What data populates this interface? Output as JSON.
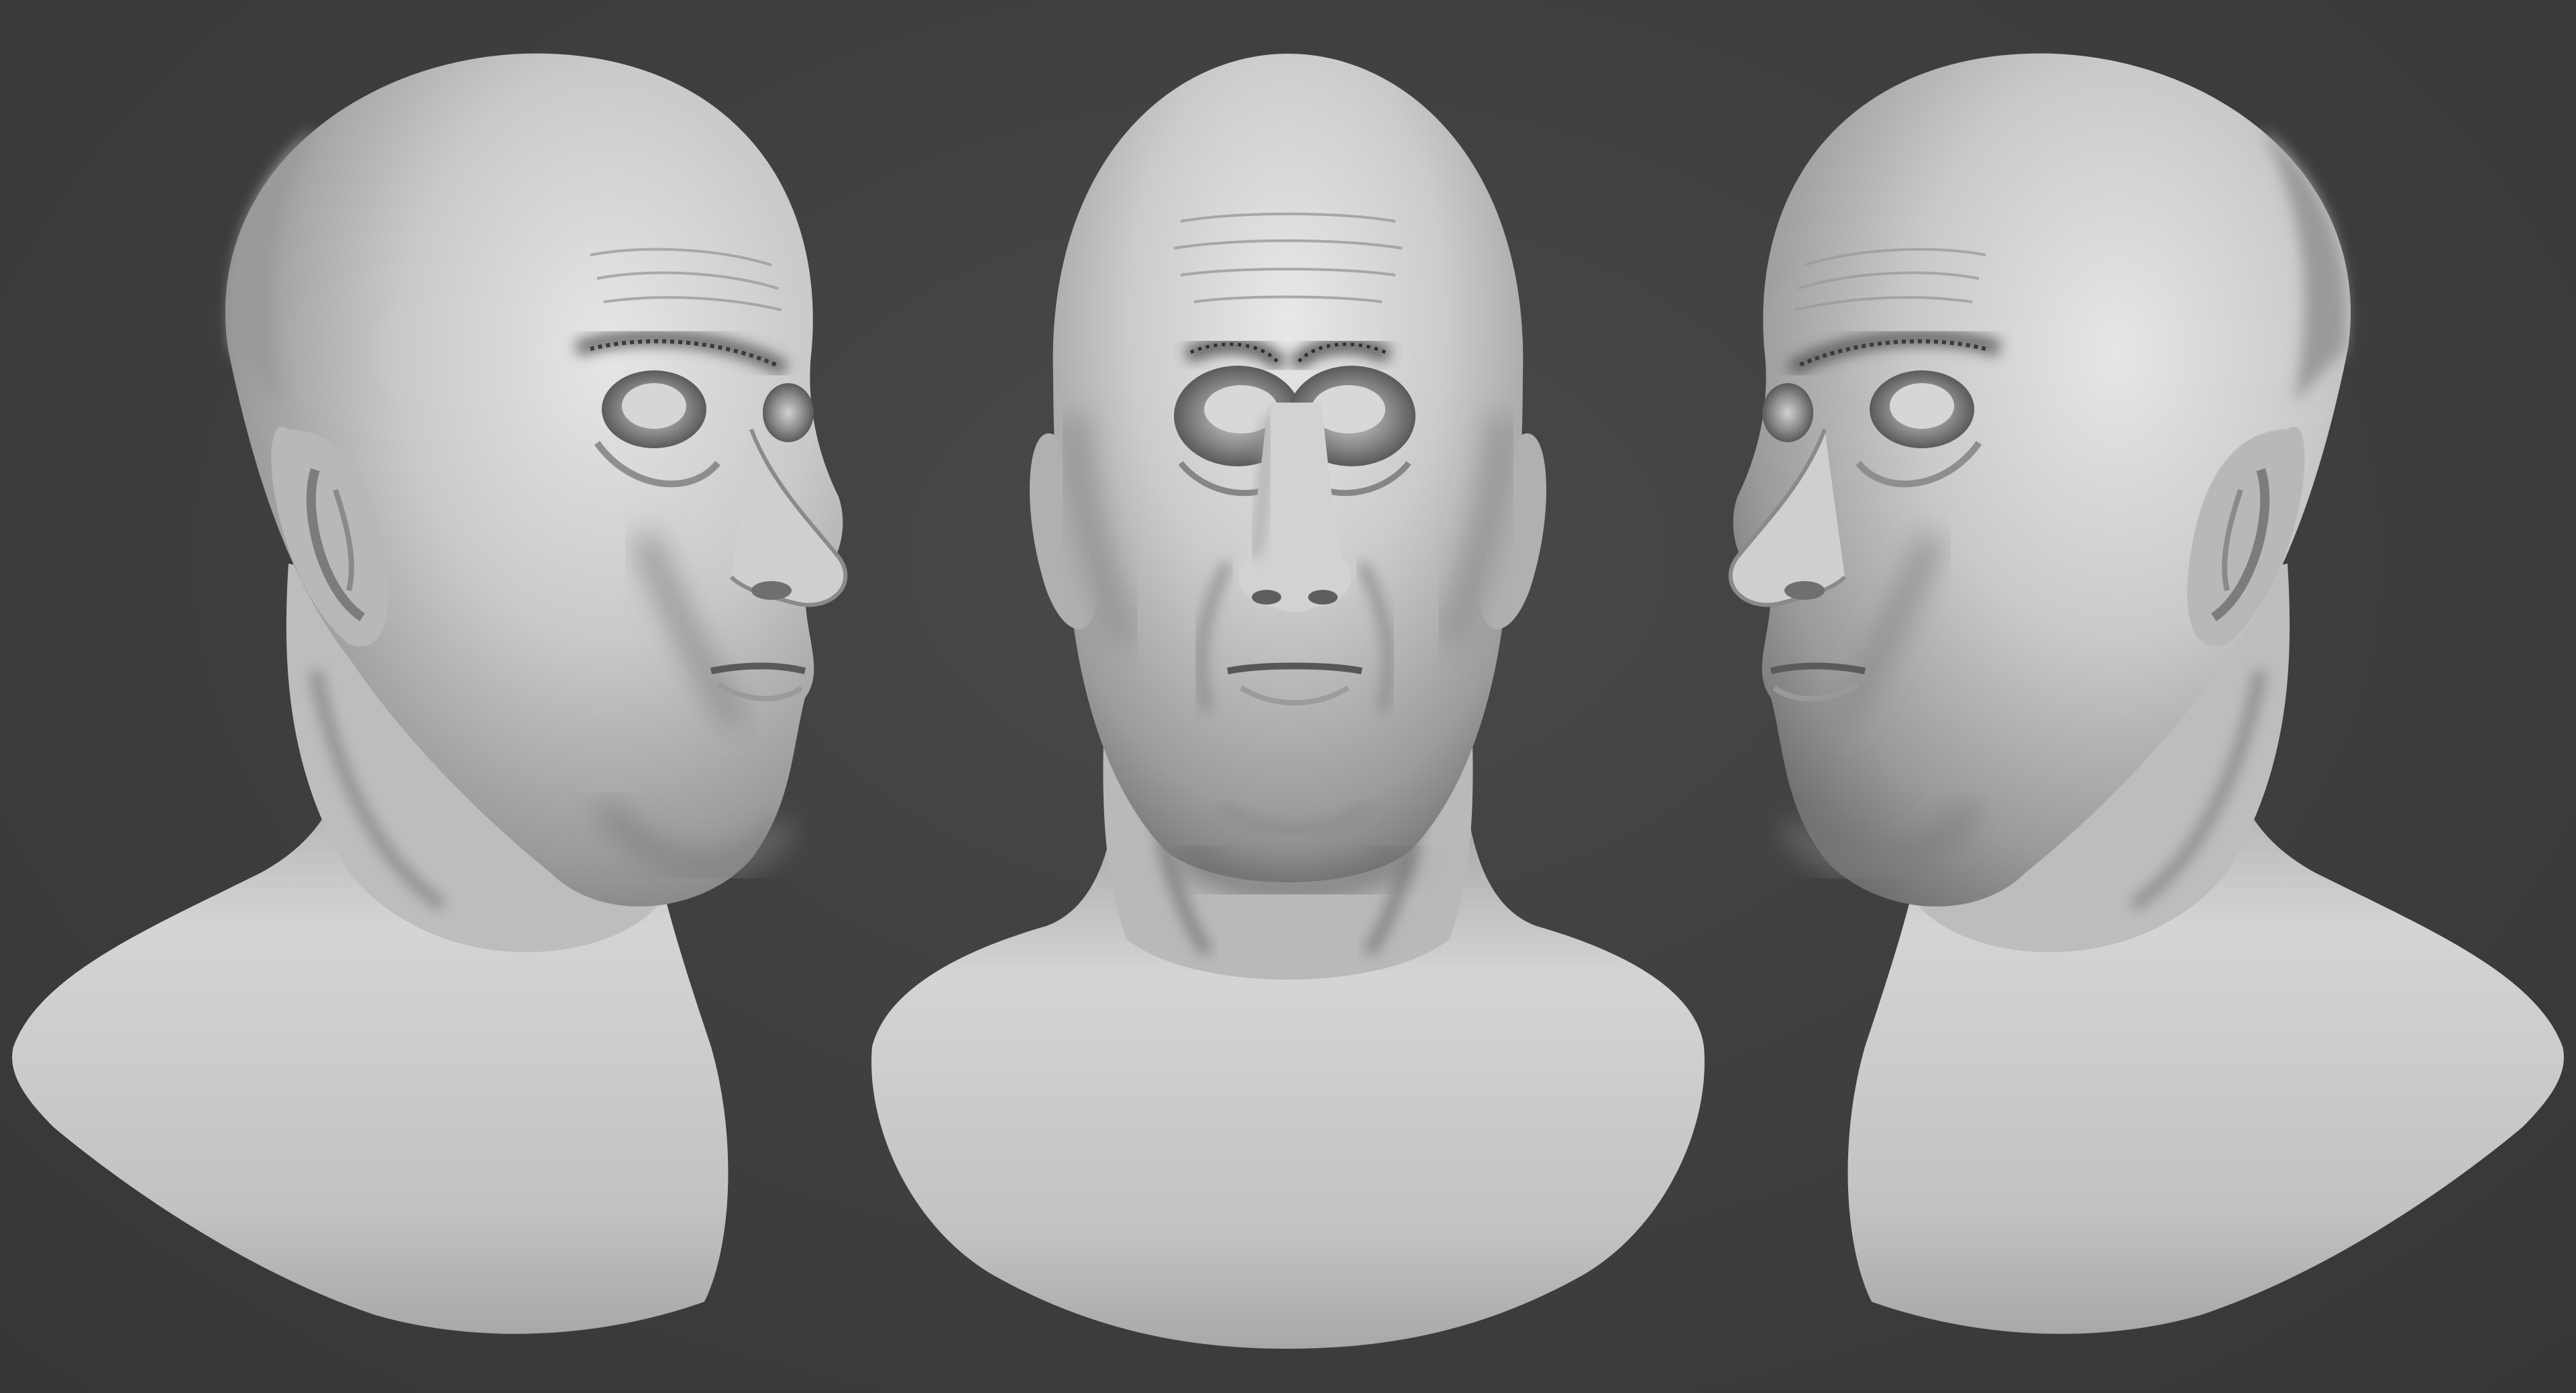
{
  "scene": {
    "description_free": true,
    "background_color": "#414141",
    "material_color": "#c8c8c8",
    "busts": [
      {
        "view": "three-quarter-right"
      },
      {
        "view": "front"
      },
      {
        "view": "three-quarter-left"
      }
    ]
  }
}
